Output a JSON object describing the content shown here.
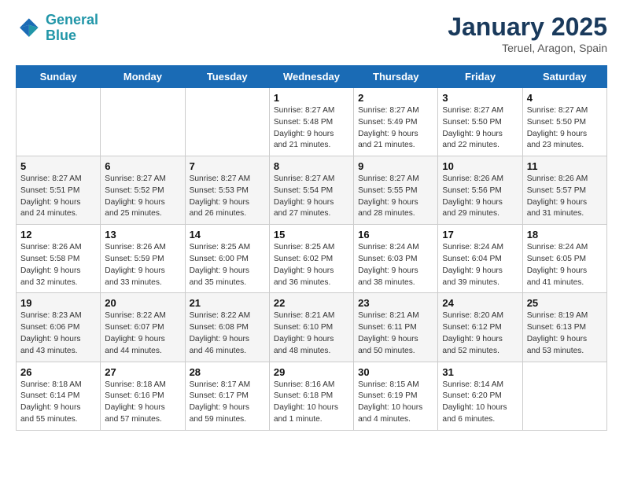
{
  "logo": {
    "line1": "General",
    "line2": "Blue"
  },
  "title": "January 2025",
  "subtitle": "Teruel, Aragon, Spain",
  "days_of_week": [
    "Sunday",
    "Monday",
    "Tuesday",
    "Wednesday",
    "Thursday",
    "Friday",
    "Saturday"
  ],
  "weeks": [
    [
      {
        "day": "",
        "info": ""
      },
      {
        "day": "",
        "info": ""
      },
      {
        "day": "",
        "info": ""
      },
      {
        "day": "1",
        "info": "Sunrise: 8:27 AM\nSunset: 5:48 PM\nDaylight: 9 hours\nand 21 minutes."
      },
      {
        "day": "2",
        "info": "Sunrise: 8:27 AM\nSunset: 5:49 PM\nDaylight: 9 hours\nand 21 minutes."
      },
      {
        "day": "3",
        "info": "Sunrise: 8:27 AM\nSunset: 5:50 PM\nDaylight: 9 hours\nand 22 minutes."
      },
      {
        "day": "4",
        "info": "Sunrise: 8:27 AM\nSunset: 5:50 PM\nDaylight: 9 hours\nand 23 minutes."
      }
    ],
    [
      {
        "day": "5",
        "info": "Sunrise: 8:27 AM\nSunset: 5:51 PM\nDaylight: 9 hours\nand 24 minutes."
      },
      {
        "day": "6",
        "info": "Sunrise: 8:27 AM\nSunset: 5:52 PM\nDaylight: 9 hours\nand 25 minutes."
      },
      {
        "day": "7",
        "info": "Sunrise: 8:27 AM\nSunset: 5:53 PM\nDaylight: 9 hours\nand 26 minutes."
      },
      {
        "day": "8",
        "info": "Sunrise: 8:27 AM\nSunset: 5:54 PM\nDaylight: 9 hours\nand 27 minutes."
      },
      {
        "day": "9",
        "info": "Sunrise: 8:27 AM\nSunset: 5:55 PM\nDaylight: 9 hours\nand 28 minutes."
      },
      {
        "day": "10",
        "info": "Sunrise: 8:26 AM\nSunset: 5:56 PM\nDaylight: 9 hours\nand 29 minutes."
      },
      {
        "day": "11",
        "info": "Sunrise: 8:26 AM\nSunset: 5:57 PM\nDaylight: 9 hours\nand 31 minutes."
      }
    ],
    [
      {
        "day": "12",
        "info": "Sunrise: 8:26 AM\nSunset: 5:58 PM\nDaylight: 9 hours\nand 32 minutes."
      },
      {
        "day": "13",
        "info": "Sunrise: 8:26 AM\nSunset: 5:59 PM\nDaylight: 9 hours\nand 33 minutes."
      },
      {
        "day": "14",
        "info": "Sunrise: 8:25 AM\nSunset: 6:00 PM\nDaylight: 9 hours\nand 35 minutes."
      },
      {
        "day": "15",
        "info": "Sunrise: 8:25 AM\nSunset: 6:02 PM\nDaylight: 9 hours\nand 36 minutes."
      },
      {
        "day": "16",
        "info": "Sunrise: 8:24 AM\nSunset: 6:03 PM\nDaylight: 9 hours\nand 38 minutes."
      },
      {
        "day": "17",
        "info": "Sunrise: 8:24 AM\nSunset: 6:04 PM\nDaylight: 9 hours\nand 39 minutes."
      },
      {
        "day": "18",
        "info": "Sunrise: 8:24 AM\nSunset: 6:05 PM\nDaylight: 9 hours\nand 41 minutes."
      }
    ],
    [
      {
        "day": "19",
        "info": "Sunrise: 8:23 AM\nSunset: 6:06 PM\nDaylight: 9 hours\nand 43 minutes."
      },
      {
        "day": "20",
        "info": "Sunrise: 8:22 AM\nSunset: 6:07 PM\nDaylight: 9 hours\nand 44 minutes."
      },
      {
        "day": "21",
        "info": "Sunrise: 8:22 AM\nSunset: 6:08 PM\nDaylight: 9 hours\nand 46 minutes."
      },
      {
        "day": "22",
        "info": "Sunrise: 8:21 AM\nSunset: 6:10 PM\nDaylight: 9 hours\nand 48 minutes."
      },
      {
        "day": "23",
        "info": "Sunrise: 8:21 AM\nSunset: 6:11 PM\nDaylight: 9 hours\nand 50 minutes."
      },
      {
        "day": "24",
        "info": "Sunrise: 8:20 AM\nSunset: 6:12 PM\nDaylight: 9 hours\nand 52 minutes."
      },
      {
        "day": "25",
        "info": "Sunrise: 8:19 AM\nSunset: 6:13 PM\nDaylight: 9 hours\nand 53 minutes."
      }
    ],
    [
      {
        "day": "26",
        "info": "Sunrise: 8:18 AM\nSunset: 6:14 PM\nDaylight: 9 hours\nand 55 minutes."
      },
      {
        "day": "27",
        "info": "Sunrise: 8:18 AM\nSunset: 6:16 PM\nDaylight: 9 hours\nand 57 minutes."
      },
      {
        "day": "28",
        "info": "Sunrise: 8:17 AM\nSunset: 6:17 PM\nDaylight: 9 hours\nand 59 minutes."
      },
      {
        "day": "29",
        "info": "Sunrise: 8:16 AM\nSunset: 6:18 PM\nDaylight: 10 hours\nand 1 minute."
      },
      {
        "day": "30",
        "info": "Sunrise: 8:15 AM\nSunset: 6:19 PM\nDaylight: 10 hours\nand 4 minutes."
      },
      {
        "day": "31",
        "info": "Sunrise: 8:14 AM\nSunset: 6:20 PM\nDaylight: 10 hours\nand 6 minutes."
      },
      {
        "day": "",
        "info": ""
      }
    ]
  ]
}
